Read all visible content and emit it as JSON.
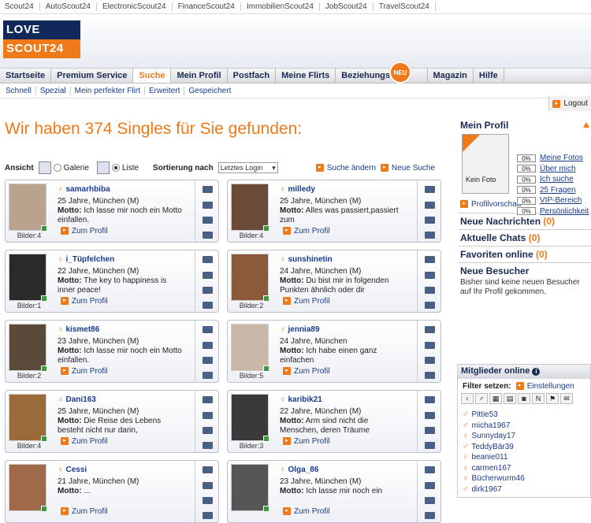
{
  "network_links": [
    "Scout24",
    "AutoScout24",
    "ElectronicScout24",
    "FinanceScout24",
    "ImmobilienScout24",
    "JobScout24",
    "TravelScout24"
  ],
  "logo": {
    "line1": "LOVE",
    "line2": "SCOUT24"
  },
  "main_nav": [
    "Startseite",
    "Premium Service",
    "Suche",
    "Mein Profil",
    "Postfach",
    "Meine Flirts",
    "Beziehungstyp",
    "Magazin",
    "Hilfe"
  ],
  "neu_badge": "NEU",
  "sub_nav": [
    "Schnell",
    "Spezial",
    "Mein perfekter Flirt",
    "Erweitert",
    "Gespeichert"
  ],
  "logout": "Logout",
  "headline": "Wir haben 374 Singles für Sie gefunden:",
  "view": {
    "label": "Ansicht",
    "galerie": "Galerie",
    "liste": "Liste",
    "selected": "Liste"
  },
  "sort": {
    "label": "Sortierung nach",
    "value": "Letztes Login"
  },
  "actions": {
    "change_search": "Suche ändern",
    "new_search": "Neue Suche"
  },
  "profile_link_label": "Zum Profil",
  "motto_label": "Motto:",
  "members": [
    {
      "name": "samarhbiba",
      "age_loc": "25 Jahre, München (M)",
      "motto": "Ich lasse mir noch ein Motto einfallen.",
      "bilder": "Bilder:4"
    },
    {
      "name": "milledy",
      "age_loc": "25 Jahre, München (M)",
      "motto": "Alles was passiert,passiert zum",
      "bilder": "Bilder:4"
    },
    {
      "name": "i_Tüpfelchen",
      "age_loc": "22 Jahre, München (M)",
      "motto": "The key to happiness is inner peace!",
      "bilder": "Bilder:1"
    },
    {
      "name": "sunshinetin",
      "age_loc": "24 Jahre, München (M)",
      "motto": "Du bist mir in folgenden Punkten ähnlich oder dir",
      "bilder": "Bilder:2"
    },
    {
      "name": "kismet86",
      "age_loc": "23 Jahre, München (M)",
      "motto": "Ich lasse mir noch ein Motto einfallen.",
      "bilder": "Bilder:2"
    },
    {
      "name": "jennia89",
      "age_loc": "24 Jahre, München",
      "motto": "Ich habe einen ganz einfachen",
      "bilder": "Bilder:5"
    },
    {
      "name": "Dani163",
      "age_loc": "25 Jahre, München (M)",
      "motto": "Die Reise des Lebens besteht nicht nur darin,",
      "bilder": "Bilder:4"
    },
    {
      "name": "karibik21",
      "age_loc": "22 Jahre, München (M)",
      "motto": "Arm sind nicht die Menschen, deren Träume",
      "bilder": "Bilder:3"
    },
    {
      "name": "Cessi",
      "age_loc": "21 Jahre, München (M)",
      "motto": "...",
      "bilder": ""
    },
    {
      "name": "Olga_86",
      "age_loc": "23 Jahre, München (M)",
      "motto": "Ich lasse mir noch ein",
      "bilder": ""
    }
  ],
  "sidebar": {
    "mein_profil": "Mein Profil",
    "kein_foto": "Kein Foto",
    "progress": [
      {
        "pct": "0%",
        "label": "Meine Fotos"
      },
      {
        "pct": "0%",
        "label": "Über mich"
      },
      {
        "pct": "0%",
        "label": "Ich suche"
      },
      {
        "pct": "0%",
        "label": "25 Fragen"
      },
      {
        "pct": "0%",
        "label": "VIP-Bereich"
      },
      {
        "pct": "0%",
        "label": "Persönlichkeit"
      }
    ],
    "profilvorschau": "Profilvorschau",
    "neue_nachrichten": "Neue Nachrichten",
    "neue_nachrichten_count": "(0)",
    "aktuelle_chats": "Aktuelle Chats",
    "aktuelle_chats_count": "(0)",
    "favoriten": "Favoriten online",
    "favoriten_count": "(0)",
    "neue_besucher": "Neue Besucher",
    "besucher_text": "Bisher sind keine neuen Besucher auf Ihr Profil gekommen."
  },
  "online": {
    "title": "Mitglieder online",
    "filter_label": "Filter setzen:",
    "settings": "Einstellungen",
    "users": [
      {
        "name": "Pittie53",
        "g": "♂"
      },
      {
        "name": "micha1967",
        "g": "♂"
      },
      {
        "name": "Sunnyday17",
        "g": "♀"
      },
      {
        "name": "TeddyBär39",
        "g": "♂"
      },
      {
        "name": "beanie011",
        "g": "♀"
      },
      {
        "name": "carmen167",
        "g": "♀"
      },
      {
        "name": "Bücherwurm46",
        "g": "♀"
      },
      {
        "name": "dirk1967",
        "g": "♂"
      }
    ]
  },
  "colors": {
    "accent": "#ee7a1a",
    "navy": "#11295a",
    "link": "#1a3a8c"
  }
}
